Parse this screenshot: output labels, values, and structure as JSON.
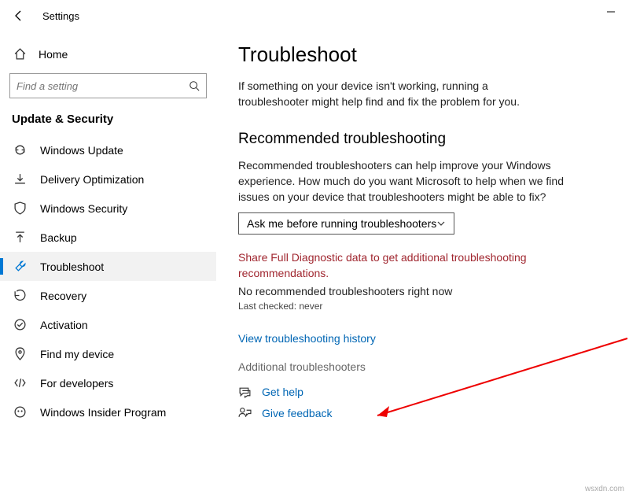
{
  "titlebar": {
    "title": "Settings"
  },
  "sidebar": {
    "home": "Home",
    "search_placeholder": "Find a setting",
    "section": "Update & Security",
    "items": [
      {
        "label": "Windows Update"
      },
      {
        "label": "Delivery Optimization"
      },
      {
        "label": "Windows Security"
      },
      {
        "label": "Backup"
      },
      {
        "label": "Troubleshoot"
      },
      {
        "label": "Recovery"
      },
      {
        "label": "Activation"
      },
      {
        "label": "Find my device"
      },
      {
        "label": "For developers"
      },
      {
        "label": "Windows Insider Program"
      }
    ]
  },
  "main": {
    "title": "Troubleshoot",
    "intro": "If something on your device isn't working, running a troubleshooter might help find and fix the problem for you.",
    "recommended": {
      "title": "Recommended troubleshooting",
      "desc": "Recommended troubleshooters can help improve your Windows experience. How much do you want Microsoft to help when we find issues on your device that troubleshooters might be able to fix?",
      "dropdown_value": "Ask me before running troubleshooters",
      "warn": "Share Full Diagnostic data to get additional troubleshooting recommendations.",
      "status": "No recommended troubleshooters right now",
      "last_checked": "Last checked: never"
    },
    "history_link": "View troubleshooting history",
    "additional": "Additional troubleshooters",
    "help": {
      "get_help": "Get help",
      "feedback": "Give feedback"
    }
  },
  "watermark": "wsxdn.com"
}
